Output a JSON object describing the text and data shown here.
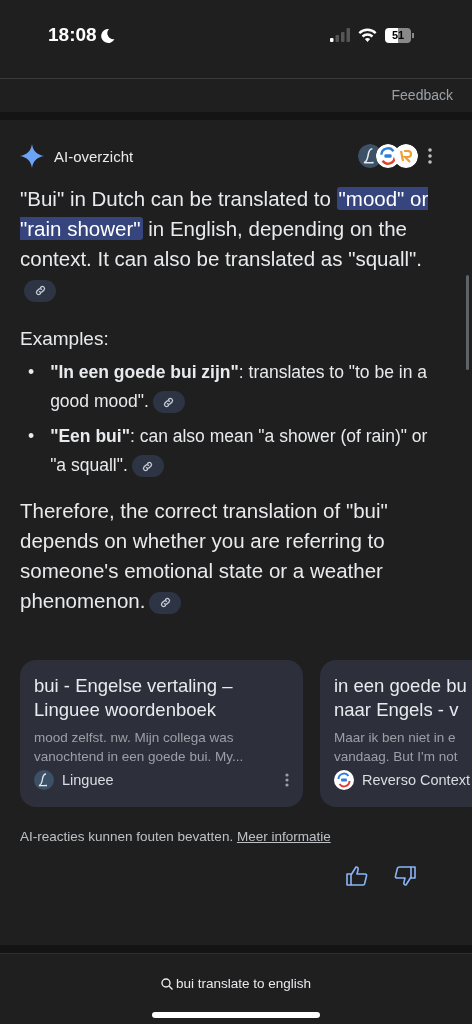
{
  "status_bar": {
    "time": "18:08",
    "battery": "51"
  },
  "feedback": "Feedback",
  "ai_overview": {
    "title": "AI-overzicht",
    "intro": {
      "before": "\"Bui\" in Dutch can be translated to ",
      "highlight": "\"mood\" or \"rain shower\"",
      "after": " in English, depending on the context. It can also be translated as \"squall\"."
    },
    "examples_heading": "Examples:",
    "examples": [
      {
        "marker": "•",
        "text": "**\"In een goede bui zijn\"**: translates to \"to be in a good mood\"."
      },
      {
        "marker": "•",
        "text": "**\"Een bui\"**: can also mean \"a shower (of rain)\" or \"a squall\"."
      }
    ],
    "conclusion": "Therefore, the correct translation of \"bui\" depends on whether you are referring to someone's emotional state or a weather phenomenon.",
    "sources": [
      {
        "title_lines": [
          "bui - Engelse vertaling –",
          "Linguee woordenboek"
        ],
        "snippet_lines": [
          "mood zelfst. nw. Mijn collega was",
          "vanochtend in een goede bui. My..."
        ],
        "site": "Linguee",
        "kind": "linguee"
      },
      {
        "title_lines": [
          "in een goede bu",
          "naar Engels - v"
        ],
        "snippet_lines": [
          "Maar ik ben niet in e",
          "vandaag. But I'm not"
        ],
        "site": "Reverso Context",
        "kind": "reverso"
      }
    ],
    "disclaimer": "AI-reacties kunnen fouten bevatten.",
    "disclaimer_link": "Meer informatie"
  },
  "bottom_search": {
    "query": "bui translate to english"
  }
}
